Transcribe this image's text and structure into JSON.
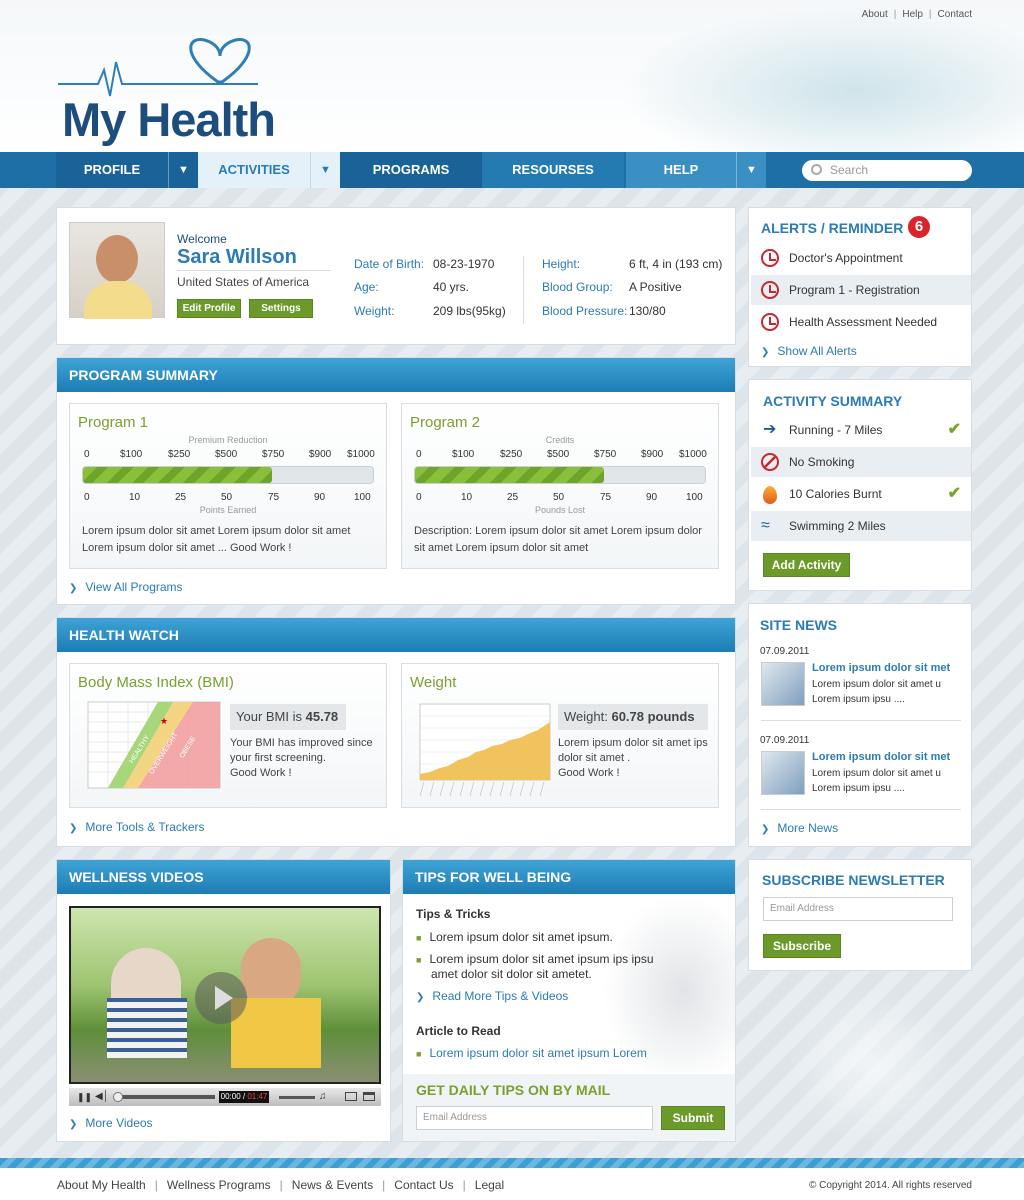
{
  "top_links": [
    "About",
    "Help",
    "Contact"
  ],
  "logo": "My Health",
  "nav": {
    "items": [
      "PROFILE",
      "ACTIVITIES",
      "PROGRAMS",
      "RESOURSES",
      "HELP"
    ],
    "search_placeholder": "Search"
  },
  "profile": {
    "welcome": "Welcome",
    "name": "Sara Willson",
    "country": "United States of America",
    "edit_label": "Edit Profile",
    "settings_label": "Settings",
    "fields_left": [
      {
        "label": "Date of Birth:",
        "value": "08-23-1970"
      },
      {
        "label": "Age:",
        "value": "40 yrs."
      },
      {
        "label": "Weight:",
        "value": "209 lbs(95kg)"
      }
    ],
    "fields_right": [
      {
        "label": "Height:",
        "value": "6 ft, 4 in (193 cm)"
      },
      {
        "label": "Blood Group:",
        "value": "A Positive"
      },
      {
        "label": "Blood Pressure:",
        "value": "130/80"
      }
    ]
  },
  "program_summary": {
    "title": "PROGRAM SUMMARY",
    "programs": [
      {
        "title": "Program 1",
        "top_caption": "Premium Reduction",
        "top_scale": [
          "0",
          "$100",
          "$250",
          "$500",
          "$750",
          "$900",
          "$1000"
        ],
        "bottom_scale": [
          "0",
          "10",
          "25",
          "50",
          "75",
          "90",
          "100"
        ],
        "bottom_caption": "Points Earned",
        "progress": 0.65,
        "desc1": "Lorem ipsum dolor sit amet Lorem ipsum dolor sit amet",
        "desc2": "Lorem ipsum dolor sit amet ... Good Work !"
      },
      {
        "title": "Program 2",
        "top_caption": "Credits",
        "top_scale": [
          "0",
          "$100",
          "$250",
          "$500",
          "$750",
          "$900",
          "$1000"
        ],
        "bottom_scale": [
          "0",
          "10",
          "25",
          "50",
          "75",
          "90",
          "100"
        ],
        "bottom_caption": "Pounds Lost",
        "progress": 0.65,
        "desc1": "Description: Lorem ipsum dolor sit amet Lorem ipsum dolor",
        "desc2": "sit amet Lorem ipsum dolor sit amet"
      }
    ],
    "view_all": "View All Programs"
  },
  "health_watch": {
    "title": "HEALTH WATCH",
    "bmi": {
      "title": "Body Mass Index (BMI)",
      "value_label": "Your BMI is",
      "value": "45.78",
      "text1": "Your BMI has improved since",
      "text2": "your first screening.",
      "text3": "Good Work !",
      "zones": [
        "HEALTHY",
        "OVERWEIGHT",
        "OBESE"
      ]
    },
    "weight": {
      "title": "Weight",
      "value_label": "Weight:",
      "value": "60.78 pounds",
      "text1": "Lorem ipsum dolor sit amet ips",
      "text2": "dolor sit amet .",
      "text3": "Good Work !"
    },
    "more": "More Tools & Trackers"
  },
  "videos": {
    "title": "WELLNESS VIDEOS",
    "time": "00:00",
    "duration": "01:47",
    "more": "More Videos"
  },
  "tips": {
    "title": "TIPS FOR WELL BEING",
    "subtitle": "Tips & Tricks",
    "items": [
      "Lorem ipsum dolor sit amet ipsum.",
      "Lorem ipsum dolor sit amet ipsum ips ipsu",
      "amet dolor sit dolor sit ametet."
    ],
    "read_more": "Read More Tips & Videos",
    "article_title": "Article to Read",
    "article": "Lorem ipsum dolor sit amet ipsum Lorem",
    "mail_title": "GET DAILY TIPS ON BY MAIL",
    "email_placeholder": "Email Address",
    "submit": "Submit"
  },
  "alerts": {
    "title": "ALERTS / REMINDER",
    "count": "6",
    "items": [
      "Doctor's Appointment",
      "Program 1 - Registration",
      "Health Assessment Needed"
    ],
    "show_all": "Show All Alerts"
  },
  "activity": {
    "title": "ACTIVITY SUMMARY",
    "items": [
      "Running - 7 Miles",
      "No Smoking",
      "10 Calories Burnt",
      "Swimming 2 Miles"
    ],
    "add": "Add Activity"
  },
  "news": {
    "title": "SITE NEWS",
    "items": [
      {
        "date": "07.09.2011",
        "headline": "Lorem ipsum dolor sit met",
        "text1": "Lorem ipsum dolor sit amet u",
        "text2": "Lorem ipsum ipsu ...."
      },
      {
        "date": "07.09.2011",
        "headline": "Lorem ipsum dolor sit met",
        "text1": "Lorem ipsum dolor sit amet u",
        "text2": "Lorem ipsum ipsu ...."
      }
    ],
    "more": "More News"
  },
  "newsletter": {
    "title": "SUBSCRIBE NEWSLETTER",
    "placeholder": "Email Address",
    "button": "Subscribe"
  },
  "footer": {
    "links": [
      "About My Health",
      "Wellness Programs",
      "News & Events",
      "Contact Us",
      "Legal"
    ],
    "copyright": "© Copyright 2014. All rights reserved"
  },
  "colors": {
    "nav": "#1e6fa5",
    "accent_blue": "#2b7bb5",
    "accent_green": "#6b9a2a",
    "alert_red": "#c8282d"
  }
}
